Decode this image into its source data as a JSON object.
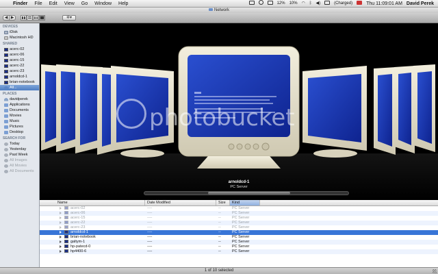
{
  "menubar": {
    "app": "Finder",
    "items": [
      "File",
      "Edit",
      "View",
      "Go",
      "Window",
      "Help"
    ],
    "status": {
      "battery_pct_1": "12%",
      "battery_pct_2": "10%",
      "battery_state": "(Charged)",
      "clock": "Thu 11:09:01 AM",
      "user": "David Perek"
    }
  },
  "window": {
    "title": "Network"
  },
  "toolbar": {
    "back": "◀",
    "forward": "▶",
    "action": "✲▾"
  },
  "sidebar": {
    "sections": [
      {
        "title": "DEVICES",
        "items": [
          {
            "label": "iDisk",
            "icon": "idisk-icon"
          },
          {
            "label": "Macintosh HD",
            "icon": "disk-icon"
          }
        ]
      },
      {
        "title": "SHARED",
        "items": [
          {
            "label": "acerc-02",
            "icon": "pc-icon"
          },
          {
            "label": "acerc-06",
            "icon": "pc-icon"
          },
          {
            "label": "acerc-15",
            "icon": "pc-icon"
          },
          {
            "label": "acerc-22",
            "icon": "pc-icon"
          },
          {
            "label": "acerc-23",
            "icon": "pc-icon"
          },
          {
            "label": "arnoldcd-1",
            "icon": "pc-icon"
          },
          {
            "label": "brian-notebook",
            "icon": "pc-icon"
          },
          {
            "label": "All...",
            "icon": "globe-icon",
            "selected": true
          }
        ]
      },
      {
        "title": "PLACES",
        "items": [
          {
            "label": "davidperek",
            "icon": "home-icon"
          },
          {
            "label": "Applications",
            "icon": "folder-icon"
          },
          {
            "label": "Documents",
            "icon": "folder-icon"
          },
          {
            "label": "Movies",
            "icon": "folder-icon"
          },
          {
            "label": "Music",
            "icon": "folder-icon"
          },
          {
            "label": "Pictures",
            "icon": "folder-icon"
          },
          {
            "label": "Desktop",
            "icon": "folder-icon"
          }
        ]
      },
      {
        "title": "SEARCH FOR",
        "items": [
          {
            "label": "Today",
            "icon": "smart-folder-icon"
          },
          {
            "label": "Yesterday",
            "icon": "smart-folder-icon"
          },
          {
            "label": "Past Week",
            "icon": "smart-folder-icon"
          },
          {
            "label": "All Images",
            "icon": "smart-folder-icon",
            "faded": true
          },
          {
            "label": "All Movies",
            "icon": "smart-folder-icon",
            "faded": true
          },
          {
            "label": "All Documents",
            "icon": "smart-folder-icon",
            "faded": true
          }
        ]
      }
    ]
  },
  "preview": {
    "name": "arnoldcd-1",
    "kind": "PC Server",
    "scroll_fraction": 0.52,
    "watermark": "photobucket"
  },
  "list": {
    "columns": [
      "Name",
      "Date Modified",
      "Size",
      "Kind"
    ],
    "rows": [
      {
        "name": "acerc-02",
        "date": "----",
        "size": "--",
        "kind": "PC Server",
        "faded": true
      },
      {
        "name": "acerc-06",
        "date": "----",
        "size": "--",
        "kind": "PC Server",
        "faded": true
      },
      {
        "name": "acerc-15",
        "date": "----",
        "size": "--",
        "kind": "PC Server",
        "faded": true
      },
      {
        "name": "acerc-22",
        "date": "----",
        "size": "--",
        "kind": "PC Server",
        "faded": true
      },
      {
        "name": "acerc-23",
        "date": "----",
        "size": "--",
        "kind": "PC Server",
        "faded": true
      },
      {
        "name": "arnoldcd-1",
        "date": "----",
        "size": "--",
        "kind": "PC Server",
        "selected": true
      },
      {
        "name": "brian-notebook",
        "date": "----",
        "size": "--",
        "kind": "PC Server"
      },
      {
        "name": "galtym-1",
        "date": "----",
        "size": "--",
        "kind": "PC Server"
      },
      {
        "name": "hp-patecd-0",
        "date": "----",
        "size": "--",
        "kind": "PC Server"
      },
      {
        "name": "hp4400-6",
        "date": "----",
        "size": "--",
        "kind": "PC Server"
      }
    ]
  },
  "statusbar": {
    "text": "1 of 10 selected"
  },
  "colors": {
    "selection": "#3875d7",
    "sidebar_bg": "#e3e7ed",
    "bsod_blue": "#1533a8"
  }
}
